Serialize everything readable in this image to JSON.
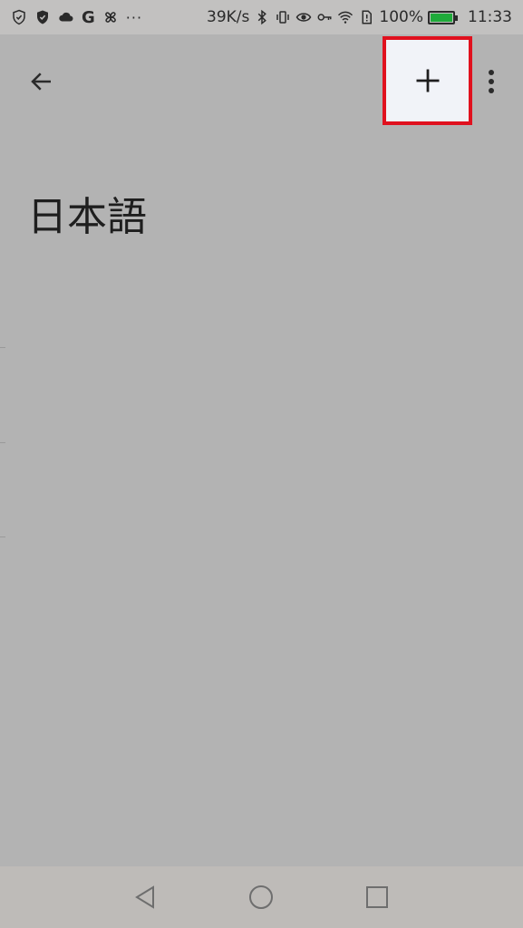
{
  "status_bar": {
    "left_icons": [
      "shield-outline-icon",
      "shield-check-icon",
      "cloud-icon",
      "google-icon",
      "pinwheel-icon",
      "more-notifications-icon"
    ],
    "google_letter": "G",
    "more_dots": "···",
    "net_speed": "39K/s",
    "battery_percent": "100%",
    "time": "11:33",
    "right_icons": [
      "bluetooth-icon",
      "vibrate-icon",
      "eye-icon",
      "key-icon",
      "wifi-icon",
      "sim-icon",
      "battery-charging-icon"
    ],
    "battery_color": "#1faa3a"
  },
  "app_bar": {
    "back_icon": "arrow-left-icon",
    "add_icon": "plus-icon",
    "more_icon": "more-vertical-icon",
    "highlight_color": "#e0111e"
  },
  "content": {
    "title": "日本語"
  },
  "nav_bar": {
    "buttons": [
      "back-triangle-icon",
      "home-circle-icon",
      "recents-square-icon"
    ]
  },
  "colors": {
    "background_dim": "#b3b3b3",
    "status_bar_bg": "#c2c1c0",
    "nav_bar_bg": "#bebbb8"
  }
}
